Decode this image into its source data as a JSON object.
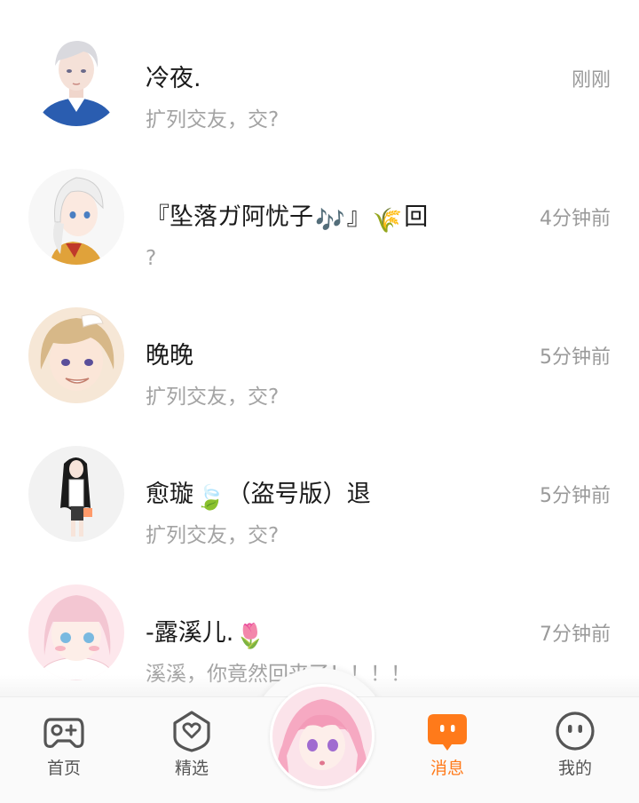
{
  "chats": [
    {
      "name": "冷夜.",
      "preview": "扩列交友，交?",
      "time": "刚刚",
      "avatar_icon": "white-haired-boy-avatar"
    },
    {
      "name_pre": "『坠落ガ阿忧子",
      "name_emoji1": "🎶",
      "name_mid": "』",
      "name_emoji2": "🌾",
      "name_post": "回",
      "preview": "?",
      "time": "4分钟前",
      "avatar_icon": "white-haired-girl-avatar"
    },
    {
      "name": "晚晚",
      "preview": "扩列交友，交?",
      "time": "5分钟前",
      "avatar_icon": "blonde-girl-avatar"
    },
    {
      "name_pre": "愈璇",
      "name_emoji1": "🍃",
      "name_post": "（盗号版）退",
      "preview": "扩列交友，交?",
      "time": "5分钟前",
      "avatar_icon": "black-haired-girl-avatar"
    },
    {
      "name_pre": "-露溪儿.",
      "name_emoji1": "🌷",
      "preview": "溪溪，你竟然回来了！！！！",
      "time": "7分钟前",
      "avatar_icon": "pink-girl-avatar"
    }
  ],
  "tabs": {
    "home": {
      "label": "首页",
      "icon": "gamepad-icon"
    },
    "featured": {
      "label": "精选",
      "icon": "heart-badge-icon"
    },
    "center": {
      "icon": "pink-haired-girl-avatar"
    },
    "messages": {
      "label": "消息",
      "icon": "chat-bubble-icon"
    },
    "mine": {
      "label": "我的",
      "icon": "face-icon"
    }
  },
  "colors": {
    "accent": "#ff7a1a",
    "name_text": "#1a1a1a",
    "preview_text": "#a3a3a3",
    "time_text": "#9a9a9a"
  }
}
